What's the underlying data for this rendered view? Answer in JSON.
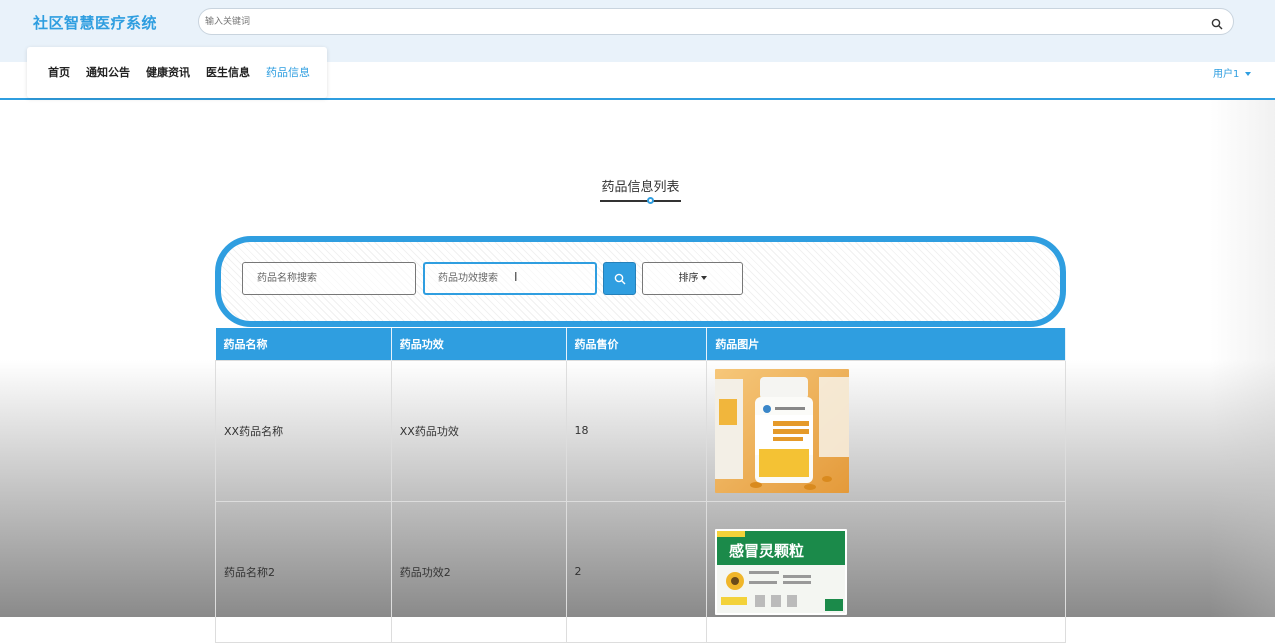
{
  "header": {
    "brand": "社区智慧医疗系统",
    "search_placeholder": "输入关键词"
  },
  "nav": {
    "items": [
      "首页",
      "通知公告",
      "健康资讯",
      "医生信息",
      "药品信息"
    ],
    "active_index": 4,
    "user": "用户1"
  },
  "page": {
    "title": "药品信息列表"
  },
  "filters": {
    "name_placeholder": "药品名称搜索",
    "effect_placeholder": "药品功效搜索",
    "sort_label": "排序"
  },
  "table": {
    "headers": [
      "药品名称",
      "药品功效",
      "药品售价",
      "药品图片"
    ],
    "rows": [
      {
        "name": "XX药品名称",
        "effect": "XX药品功效",
        "price": "18",
        "image": "pill-bottle-photo"
      },
      {
        "name": "药品名称2",
        "effect": "药品功效2",
        "price": "2",
        "image": "medicine-box-photo",
        "image_text": "感冒灵颗粒"
      }
    ]
  },
  "colors": {
    "accent": "#2f9ee0",
    "topbar_bg": "#e9f2fa"
  }
}
